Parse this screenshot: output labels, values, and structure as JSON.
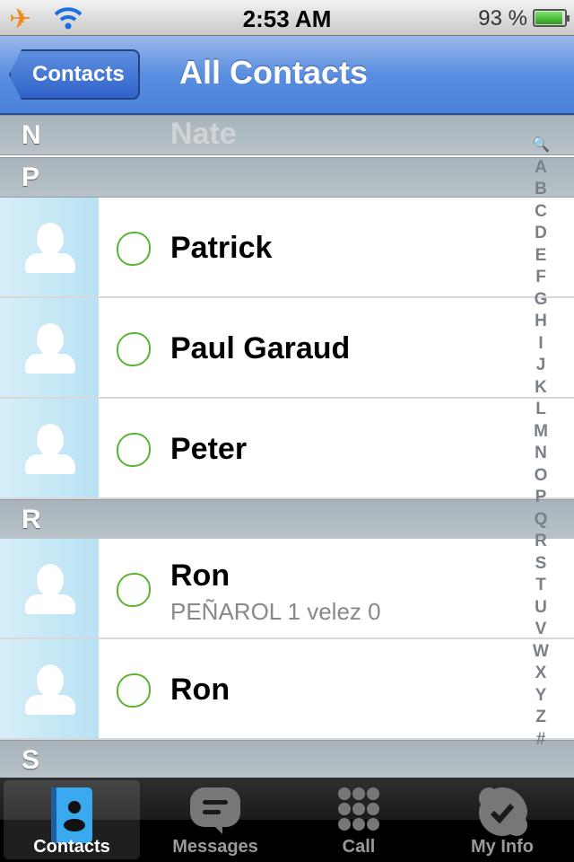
{
  "status": {
    "time": "2:53 AM",
    "battery": "93 %",
    "battery_level": 0.93,
    "icons": [
      "airplane-icon",
      "wifi-icon",
      "battery-icon"
    ]
  },
  "nav": {
    "back_label": "Contacts",
    "title": "All Contacts"
  },
  "ghost_contact": "Nate",
  "sections": [
    {
      "letter": "N"
    },
    {
      "letter": "P",
      "contacts": [
        {
          "name": "Patrick"
        },
        {
          "name": "Paul Garaud"
        },
        {
          "name": "Peter"
        }
      ]
    },
    {
      "letter": "R",
      "contacts": [
        {
          "name": "Ron",
          "mood": "PEÑAROL 1 velez 0"
        },
        {
          "name": "Ron"
        }
      ]
    },
    {
      "letter": "S"
    }
  ],
  "index": [
    "🔍",
    "A",
    "B",
    "C",
    "D",
    "E",
    "F",
    "G",
    "H",
    "I",
    "J",
    "K",
    "L",
    "M",
    "N",
    "O",
    "P",
    "Q",
    "R",
    "S",
    "T",
    "U",
    "V",
    "W",
    "X",
    "Y",
    "Z",
    "#"
  ],
  "tabs": [
    {
      "label": "Contacts",
      "active": true
    },
    {
      "label": "Messages"
    },
    {
      "label": "Call"
    },
    {
      "label": "My Info"
    }
  ],
  "colors": {
    "nav": "#4a80d8",
    "skype_status": "#5bb336",
    "tabbar": "#000000"
  }
}
